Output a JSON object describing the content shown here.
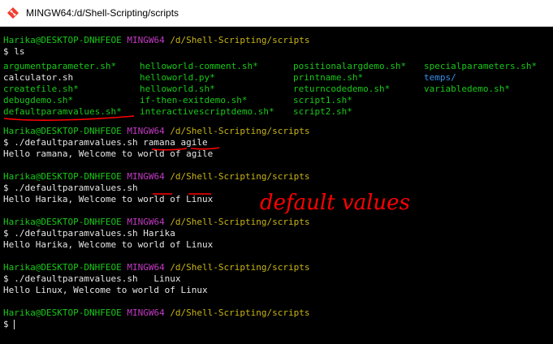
{
  "window": {
    "title": "MINGW64:/d/Shell-Scripting/scripts",
    "icon": "git-bash-icon"
  },
  "prompt": {
    "user_host": "Harika@DESKTOP-DNHFEOE",
    "env": "MINGW64",
    "path": "/d/Shell-Scripting/scripts",
    "symbol": "$"
  },
  "session": [
    {
      "cmd": "ls"
    },
    {
      "cmd": "./defaultparamvalues.sh ramana agile",
      "out": "Hello ramana, Welcome to world of agile"
    },
    {
      "cmd": "./defaultparamvalues.sh",
      "out": "Hello Harika, Welcome to world of Linux"
    },
    {
      "cmd": "./defaultparamvalues.sh Harika",
      "out": "Hello Harika, Welcome to world of Linux"
    },
    {
      "cmd": "./defaultparamvalues.sh   Linux",
      "out": "Hello Linux, Welcome to world of Linux"
    }
  ],
  "ls_files": [
    {
      "name": "argumentparameter.sh*",
      "type": "exec"
    },
    {
      "name": "helloworld-comment.sh*",
      "type": "exec"
    },
    {
      "name": "positionalargdemo.sh*",
      "type": "exec"
    },
    {
      "name": "specialparameters.sh*",
      "type": "exec"
    },
    {
      "name": "calculator.sh",
      "type": "file"
    },
    {
      "name": "helloworld.py*",
      "type": "exec"
    },
    {
      "name": "printname.sh*",
      "type": "exec"
    },
    {
      "name": "temps/",
      "type": "dir"
    },
    {
      "name": "createfile.sh*",
      "type": "exec"
    },
    {
      "name": "helloworld.sh*",
      "type": "exec"
    },
    {
      "name": "returncodedemo.sh*",
      "type": "exec"
    },
    {
      "name": "variabledemo.sh*",
      "type": "exec"
    },
    {
      "name": "debugdemo.sh*",
      "type": "exec"
    },
    {
      "name": "if-then-exitdemo.sh*",
      "type": "exec"
    },
    {
      "name": "script1.sh*",
      "type": "exec"
    },
    {
      "name": "",
      "type": "none"
    },
    {
      "name": "defaultparamvalues.sh*",
      "type": "exec"
    },
    {
      "name": "interactivescriptdemo.sh*",
      "type": "exec"
    },
    {
      "name": "script2.sh*",
      "type": "exec"
    },
    {
      "name": "",
      "type": "none"
    }
  ],
  "annotation": {
    "text": "default values",
    "color": "#ff0000"
  },
  "colors": {
    "prompt_user": "#19c819",
    "prompt_env": "#c33ac3",
    "prompt_path": "#c8b418",
    "exec_file": "#19c819",
    "dir": "#3b8eea",
    "plain": "#e6e6e6"
  }
}
